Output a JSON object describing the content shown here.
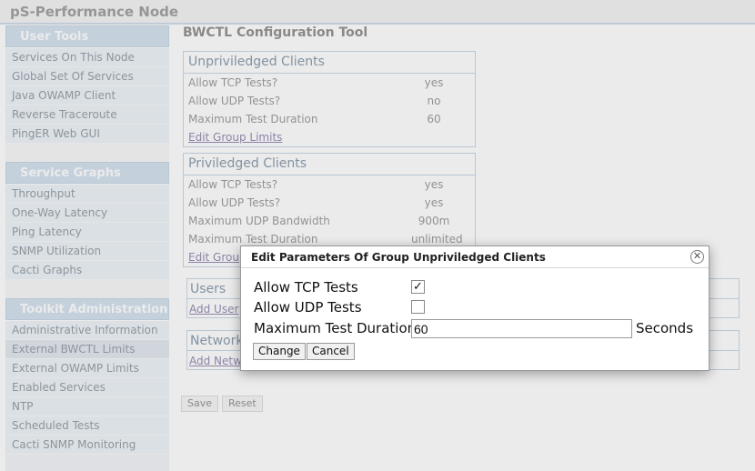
{
  "site_title": "pS-Performance Node",
  "sidebar": {
    "user_tools": {
      "header": "User Tools",
      "items": [
        "Services On This Node",
        "Global Set Of Services",
        "Java OWAMP Client",
        "Reverse Traceroute",
        "PingER Web GUI"
      ]
    },
    "service_graphs": {
      "header": "Service Graphs",
      "items": [
        "Throughput",
        "One-Way Latency",
        "Ping Latency",
        "SNMP Utilization",
        "Cacti Graphs"
      ]
    },
    "toolkit_admin": {
      "header": "Toolkit Administration",
      "items": [
        "Administrative Information",
        "External BWCTL Limits",
        "External OWAMP Limits",
        "Enabled Services",
        "NTP",
        "Scheduled Tests",
        "Cacti SNMP Monitoring"
      ]
    }
  },
  "main": {
    "title": "BWCTL Configuration Tool",
    "unpriv": {
      "header": "Unpriviledged Clients",
      "rows": [
        {
          "label": "Allow TCP Tests?",
          "value": "yes"
        },
        {
          "label": "Allow UDP Tests?",
          "value": "no"
        },
        {
          "label": "Maximum Test Duration",
          "value": "60"
        }
      ],
      "link": "Edit Group Limits"
    },
    "priv": {
      "header": "Priviledged Clients",
      "rows": [
        {
          "label": "Allow TCP Tests?",
          "value": "yes"
        },
        {
          "label": "Allow UDP Tests?",
          "value": "yes"
        },
        {
          "label": "Maximum UDP Bandwidth",
          "value": "900m"
        },
        {
          "label": "Maximum Test Duration",
          "value": "unlimited"
        }
      ],
      "link": "Edit Group Limits"
    },
    "users": {
      "header": "Users",
      "link": "Add User"
    },
    "networks": {
      "header": "Network",
      "link": "Add Network"
    },
    "save_label": "Save",
    "reset_label": "Reset"
  },
  "dialog": {
    "title": "Edit Parameters Of Group Unpriviledged Clients",
    "close_icon": "close-icon",
    "tcp_label": "Allow TCP Tests",
    "tcp_checked": true,
    "udp_label": "Allow UDP Tests",
    "udp_checked": false,
    "duration_label": "Maximum Test Duration",
    "duration_value": "60",
    "duration_units": "Seconds",
    "change_label": "Change",
    "cancel_label": "Cancel"
  }
}
